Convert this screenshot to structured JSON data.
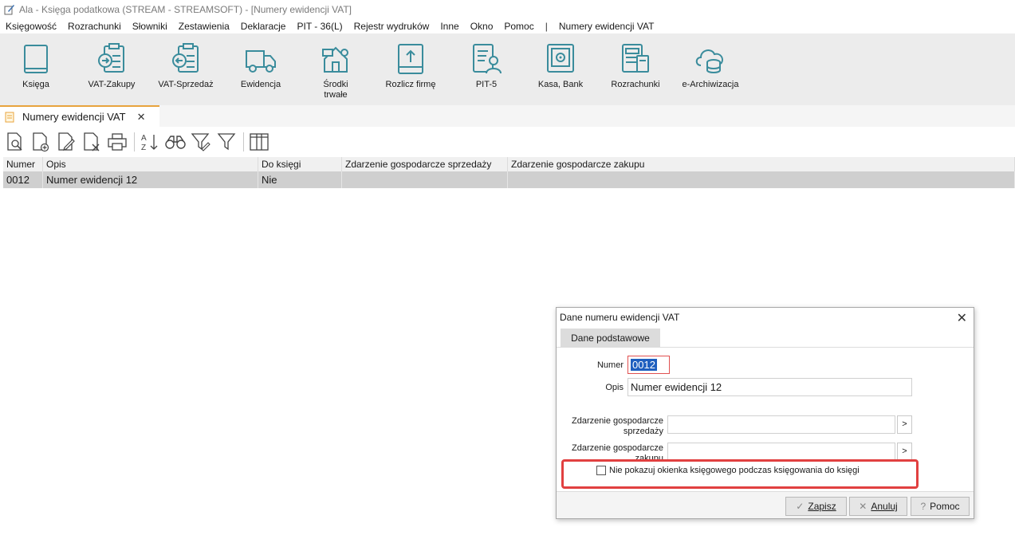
{
  "window": {
    "title": "Ala - Księga podatkowa (STREAM - STREAMSOFT) - [Numery ewidencji VAT]"
  },
  "menu": {
    "items": [
      "Księgowość",
      "Rozrachunki",
      "Słowniki",
      "Zestawienia",
      "Deklaracje",
      "PIT - 36(L)",
      "Rejestr wydruków",
      "Inne",
      "Okno",
      "Pomoc"
    ],
    "separator": "|",
    "context_item": "Numery ewidencji VAT"
  },
  "ribbon": {
    "buttons": [
      {
        "label": "Księga",
        "icon": "book-icon"
      },
      {
        "label": "VAT-Zakupy",
        "icon": "clipboard-arrow-in-icon"
      },
      {
        "label": "VAT-Sprzedaż",
        "icon": "clipboard-arrow-out-icon"
      },
      {
        "label": "Ewidencja",
        "icon": "truck-icon"
      },
      {
        "label": "Środki trwałe",
        "icon": "assets-house-icon"
      },
      {
        "label": "Rozlicz firmę",
        "icon": "document-upload-icon"
      },
      {
        "label": "PIT-5",
        "icon": "tax-form-person-icon"
      },
      {
        "label": "Kasa, Bank",
        "icon": "safe-icon"
      },
      {
        "label": "Rozrachunki",
        "icon": "settlements-icon"
      },
      {
        "label": "e-Archiwizacja",
        "icon": "cloud-database-icon"
      }
    ]
  },
  "tab": {
    "label": "Numery ewidencji VAT",
    "close": "✕"
  },
  "grid": {
    "columns": [
      "Numer",
      "Opis",
      "Do księgi",
      "Zdarzenie gospodarcze sprzedaży",
      "Zdarzenie gospodarcze zakupu"
    ],
    "rows": [
      {
        "numer": "0012",
        "opis": "Numer ewidencji 12",
        "do_ksiegi": "Nie",
        "zdarzenie_sprzedazy": "",
        "zdarzenie_zakupu": ""
      }
    ]
  },
  "dialog": {
    "title": "Dane numeru ewidencji VAT",
    "close": "✕",
    "tab": "Dane podstawowe",
    "numer_label": "Numer",
    "numer_value": "0012",
    "opis_label": "Opis",
    "opis_value": "Numer ewidencji 12",
    "sprzedazy_label_1": "Zdarzenie gospodarcze",
    "sprzedazy_label_2": "sprzedaży",
    "zakupu_label_1": "Zdarzenie gospodarcze",
    "zakupu_label_2": "zakupu",
    "picker": ">",
    "checkbox_label": "Nie pokazuj okienka księgowego podczas księgowania do księgi",
    "checkbox_checked": false,
    "buttons": {
      "save": {
        "label": "Zapisz",
        "icon": "check-icon"
      },
      "cancel": {
        "label": "Anuluj",
        "icon": "cancel-x-icon"
      },
      "help": {
        "label": "Pomoc",
        "icon": "question-icon"
      }
    },
    "highlight_color": "#e14040"
  },
  "colors": {
    "ribbon_bg": "#ececec",
    "selected_row": "#cfcfcf",
    "tab_accent": "#e8a33d",
    "icon_teal": "#3a8c9c"
  }
}
